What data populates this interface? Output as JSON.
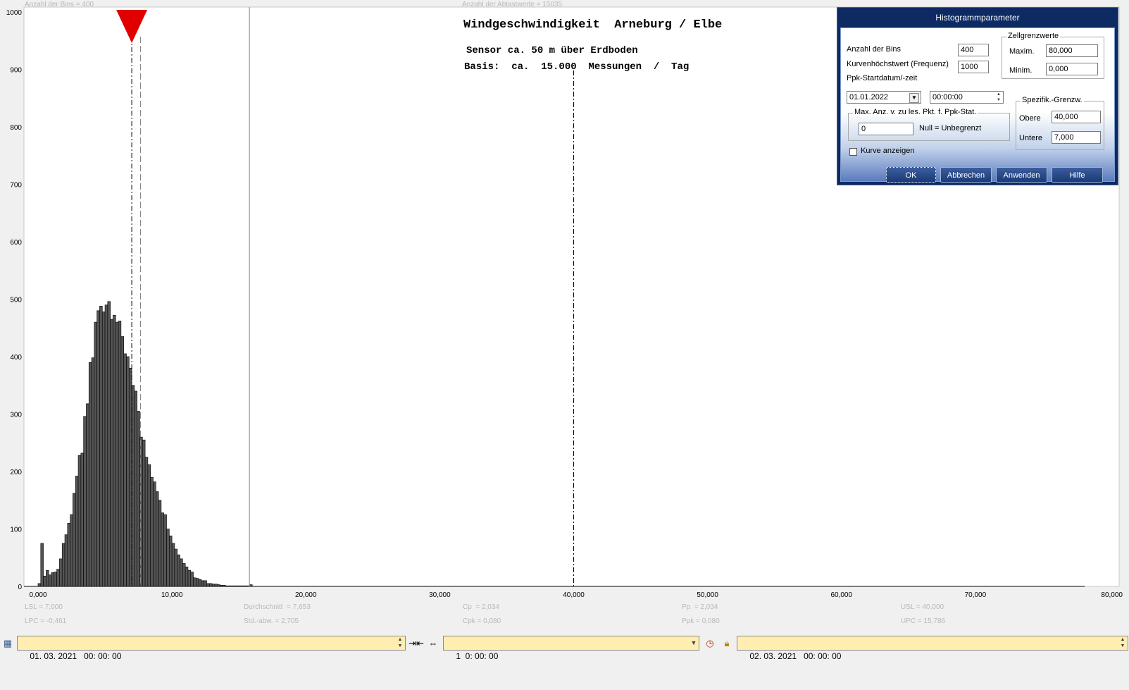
{
  "top_info": {
    "bins_info": "Anzahl der Bins =   400",
    "samples_info": "Anzahl der Abtastwerte = 15035"
  },
  "chart_data": {
    "type": "bar",
    "title": "Windgeschwindigkeit  Arneburg / Elbe",
    "subtitle1": "Sensor ca. 50 m über Erdboden",
    "subtitle2": "Basis:  ca.  15.000  Messungen  /  Tag",
    "xlim": [
      0,
      80
    ],
    "ylim": [
      0,
      1000
    ],
    "x_ticks": [
      0,
      10,
      20,
      30,
      40,
      50,
      60,
      70,
      80
    ],
    "x_tick_labels": [
      "0,000",
      "10,000",
      "20,000",
      "30,000",
      "40,000",
      "50,000",
      "60,000",
      "70,000",
      "80,000"
    ],
    "y_ticks": [
      0,
      100,
      200,
      300,
      400,
      500,
      600,
      700,
      800,
      900,
      1000
    ],
    "y_tick_labels": [
      "0",
      "100",
      "200",
      "300",
      "400",
      "500",
      "600",
      "700",
      "800",
      "900",
      "1000"
    ],
    "bin_width": 0.2,
    "bin_start": 0,
    "values": [
      5,
      75,
      18,
      28,
      20,
      24,
      25,
      30,
      48,
      75,
      90,
      110,
      125,
      162,
      192,
      228,
      232,
      296,
      318,
      390,
      398,
      460,
      480,
      488,
      478,
      490,
      496,
      465,
      472,
      460,
      462,
      435,
      405,
      400,
      380,
      350,
      340,
      305,
      260,
      255,
      225,
      212,
      190,
      182,
      165,
      150,
      128,
      125,
      100,
      88,
      75,
      65,
      55,
      48,
      40,
      34,
      28,
      25,
      15,
      14,
      12,
      10,
      10,
      5,
      5,
      4,
      4,
      3,
      2,
      2,
      1,
      1,
      1,
      1,
      1,
      1,
      1,
      1,
      1,
      3
    ],
    "markers": {
      "LSL": 7.0,
      "mean": 7.653,
      "USL": 40.0,
      "UPC": 15.786,
      "arrow_x": 7.0
    },
    "colors": {
      "bar_fill": "#555555",
      "bar_stroke": "#000000",
      "arrow": "#e00000"
    }
  },
  "stats": {
    "lsl": "LSL = 7,000",
    "lpc": "LPC = -0,461",
    "mean": "Durchschnitt  = 7,653",
    "std": "Std.-abw. = 2,705",
    "cp": "Cp  = 2,034",
    "cpk": "Cpk = 0,080",
    "pp": "Pp  = 2,034",
    "ppk": "Ppk = 0,080",
    "usl": "USL = 40,000",
    "upc": "UPC = 15,786"
  },
  "dialog": {
    "title": "Histogrammparameter",
    "bins_label": "Anzahl der Bins",
    "bins_value": "400",
    "curve_max_label": "Kurvenhöchstwert (Frequenz)",
    "curve_max_value": "1000",
    "ppk_start_label": "Ppk-Startdatum/-zeit",
    "start_date": "01.01.2022",
    "start_time": "00:00:00",
    "cell_group_title": "Zellgrenzwerte",
    "max_label": "Maxim.",
    "max_value": "80,000",
    "min_label": "Minim.",
    "min_value": "0,000",
    "maxpts_group_title": "Max. Anz. v. zu les. Pkt. f. Ppk-Stat.",
    "maxpts_value": "0",
    "maxpts_hint": "Null = Unbegrenzt",
    "spec_group_title": "Spezifik.-Grenzw.",
    "upper_label": "Obere",
    "upper_value": "40,000",
    "lower_label": "Untere",
    "lower_value": "7,000",
    "show_curve_label": "Kurve anzeigen",
    "show_curve_checked": false,
    "ok_label": "OK",
    "cancel_label": "Abbrechen",
    "apply_label": "Anwenden",
    "help_label": "Hilfe"
  },
  "bottom_bar": {
    "start_datetime": "01. 03. 2021   00: 00: 00",
    "interval": "1  0: 00: 00",
    "end_datetime": "02. 03. 2021   00: 00: 00",
    "calendar_icon": "calendar-icon",
    "shrink_icon": "shrink-arrows-icon",
    "expand_icon": "expand-arrows-icon",
    "clock_icon": "clock-icon",
    "lock_icon": "lock-icon"
  }
}
